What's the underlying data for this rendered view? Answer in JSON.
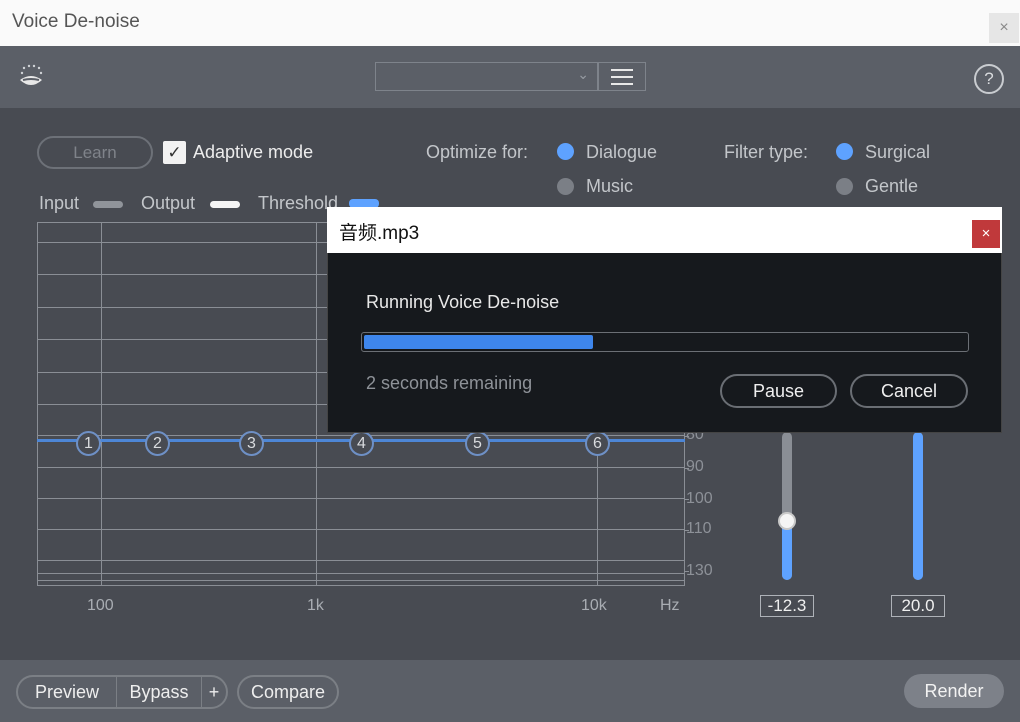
{
  "window": {
    "title": "Voice De-noise",
    "close_label": "×"
  },
  "toolbar": {
    "preset_value": "",
    "help_label": "?"
  },
  "controls": {
    "learn_label": "Learn",
    "adaptive_label": "Adaptive mode",
    "adaptive_checked": true,
    "optimize_label": "Optimize for:",
    "optimize_options": [
      "Dialogue",
      "Music"
    ],
    "optimize_selected": "Dialogue",
    "filter_label": "Filter type:",
    "filter_options": [
      "Surgical",
      "Gentle"
    ],
    "filter_selected": "Surgical"
  },
  "legend": {
    "input": "Input",
    "output": "Output",
    "threshold": "Threshold"
  },
  "graph": {
    "x_ticks": [
      "100",
      "1k",
      "10k",
      "Hz"
    ],
    "y_ticks": [
      "80",
      "90",
      "100",
      "110",
      "130"
    ],
    "band_nodes": [
      "1",
      "2",
      "3",
      "4",
      "5",
      "6"
    ]
  },
  "sliders": [
    {
      "value_label": "-12.3",
      "level": 0.4
    },
    {
      "value_label": "20.0",
      "level": 1.0
    }
  ],
  "dialog": {
    "title": "音频.mp3",
    "close_label": "×",
    "message": "Running Voice De-noise",
    "progress": 0.38,
    "remaining": "2 seconds remaining",
    "pause_label": "Pause",
    "cancel_label": "Cancel"
  },
  "bottom": {
    "preview_label": "Preview",
    "bypass_label": "Bypass",
    "plus_label": "+",
    "compare_label": "Compare",
    "render_label": "Render"
  },
  "colors": {
    "accent": "#5ea2ff",
    "progress": "#3e86ec",
    "dialog_close": "#c0393b"
  }
}
